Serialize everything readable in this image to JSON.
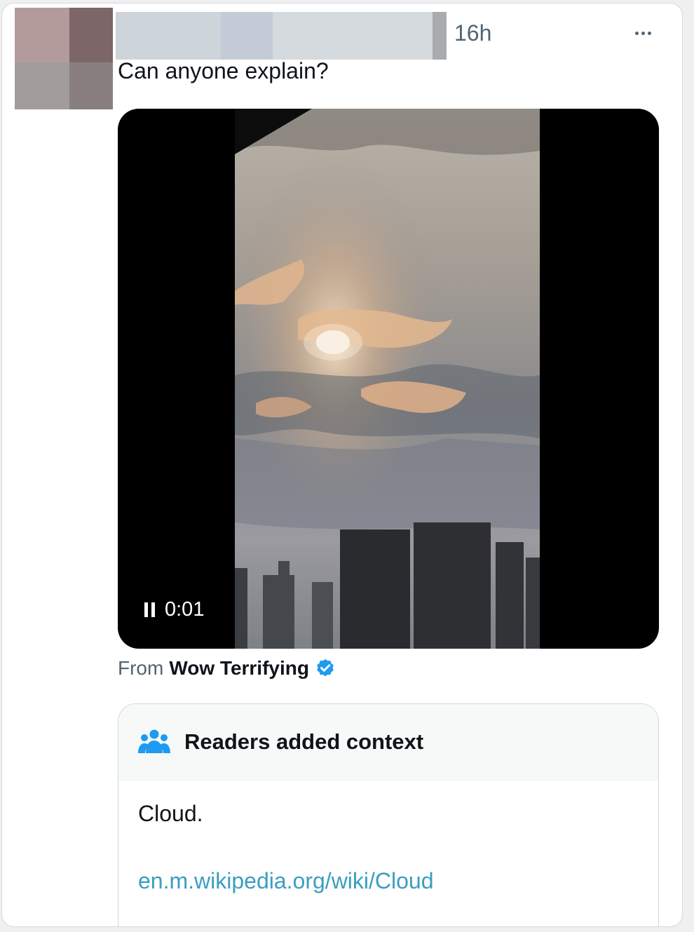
{
  "post": {
    "timestamp": "16h",
    "text": "Can anyone explain?",
    "more_icon": "more-horizontal-icon"
  },
  "video": {
    "elapsed": "0:01",
    "state_icon": "pause-icon"
  },
  "source": {
    "prefix": "From",
    "name": "Wow Terrifying",
    "badge_icon": "verified-badge-icon"
  },
  "note": {
    "title": "Readers added context",
    "body": "Cloud.",
    "link": "en.m.wikipedia.org/wiki/Cloud",
    "icon": "readers-icon"
  },
  "colors": {
    "accent": "#1d9bf0",
    "link": "#3a9ec0",
    "muted_text": "#536471"
  }
}
